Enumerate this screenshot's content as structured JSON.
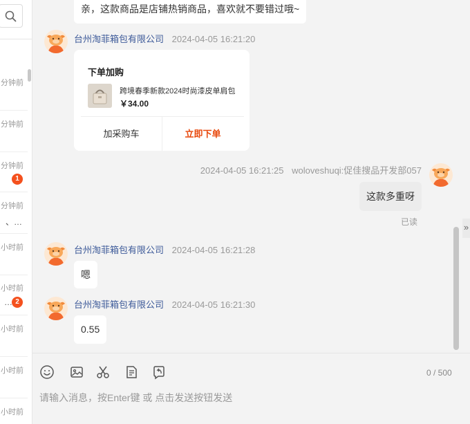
{
  "sidebar": {
    "conversations": [
      {
        "time": "分钟前",
        "preview": "",
        "badge": ""
      },
      {
        "time": "分钟前",
        "preview": "",
        "badge": ""
      },
      {
        "time": "分钟前",
        "preview": "",
        "badge": "1"
      },
      {
        "time": "分钟前",
        "preview": "、…",
        "badge": ""
      },
      {
        "time": "小时前",
        "preview": "",
        "badge": ""
      },
      {
        "time": "小时前",
        "preview": "…",
        "badge": "2"
      },
      {
        "time": "小时前",
        "preview": "",
        "badge": ""
      },
      {
        "time": "小时前",
        "preview": "",
        "badge": ""
      },
      {
        "time": "小时前",
        "preview": "",
        "badge": ""
      }
    ]
  },
  "messages": {
    "m0": {
      "text": "亲，这款商品是店铺热销商品，喜欢就不要错过哦~"
    },
    "m1": {
      "sender": "台州淘菲箱包有限公司",
      "time": "2024-04-05 16:21:20"
    },
    "card": {
      "title": "下单加购",
      "product": "跨境春季新款2024时尚漆皮单肩包",
      "price": "￥34.00",
      "cart_label": "加采购车",
      "buy_label": "立即下单"
    },
    "m2": {
      "time": "2024-04-05 16:21:25",
      "sender": "woloveshuqi:促佳搜品开发部057",
      "text": "这款多重呀",
      "status": "已读"
    },
    "m3": {
      "sender": "台州淘菲箱包有限公司",
      "time": "2024-04-05 16:21:28",
      "text": "嗯"
    },
    "m4": {
      "sender": "台州淘菲箱包有限公司",
      "time": "2024-04-05 16:21:30",
      "text": "0.55"
    }
  },
  "composer": {
    "counter": "0 / 500",
    "placeholder": "请输入消息，按Enter键 或 点击发送按钮发送"
  },
  "colors": {
    "link_name": "#3d5a99",
    "buy_accent": "#e8480c",
    "badge": "#f4511e"
  }
}
